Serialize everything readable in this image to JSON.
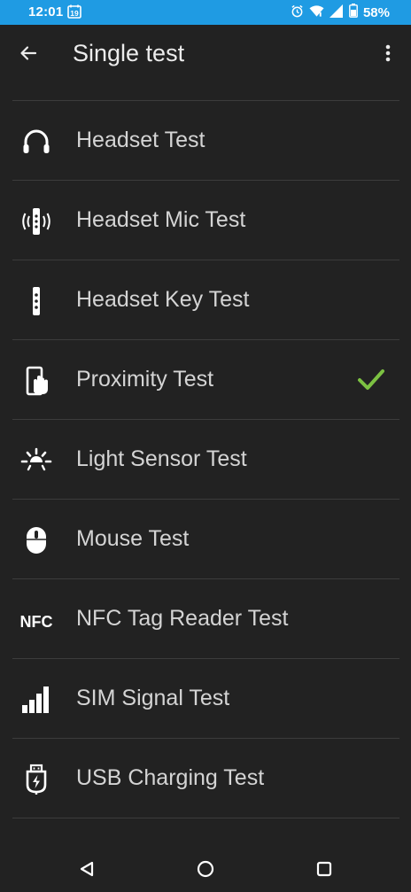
{
  "status_bar": {
    "time": "12:01",
    "calendar_day": "19",
    "battery_percent": "58%",
    "icons": [
      "alarm-icon",
      "wifi-icon",
      "signal-icon",
      "battery-icon"
    ]
  },
  "app_bar": {
    "title": "Single test",
    "back_icon": "arrow-left-icon",
    "menu_icon": "more-vert-icon"
  },
  "tests": [
    {
      "label": "Headset Test",
      "icon": "headset-icon",
      "passed": false
    },
    {
      "label": "Headset Mic Test",
      "icon": "headset-mic-icon",
      "passed": false
    },
    {
      "label": "Headset Key Test",
      "icon": "headset-key-icon",
      "passed": false
    },
    {
      "label": "Proximity Test",
      "icon": "proximity-icon",
      "passed": true
    },
    {
      "label": "Light Sensor Test",
      "icon": "light-sensor-icon",
      "passed": false
    },
    {
      "label": "Mouse Test",
      "icon": "mouse-icon",
      "passed": false
    },
    {
      "label": "NFC Tag Reader Test",
      "icon": "nfc-icon",
      "passed": false
    },
    {
      "label": "SIM Signal Test",
      "icon": "sim-signal-icon",
      "passed": false
    },
    {
      "label": "USB Charging Test",
      "icon": "usb-charging-icon",
      "passed": false
    }
  ],
  "nfc_icon_text": "NFC",
  "colors": {
    "status_bar": "#1f9be3",
    "background": "#222222",
    "divider": "#3c3c3c",
    "check": "#7cc142"
  },
  "nav_bar": {
    "icons": [
      "back-triangle-icon",
      "home-circle-icon",
      "recents-square-icon"
    ]
  }
}
